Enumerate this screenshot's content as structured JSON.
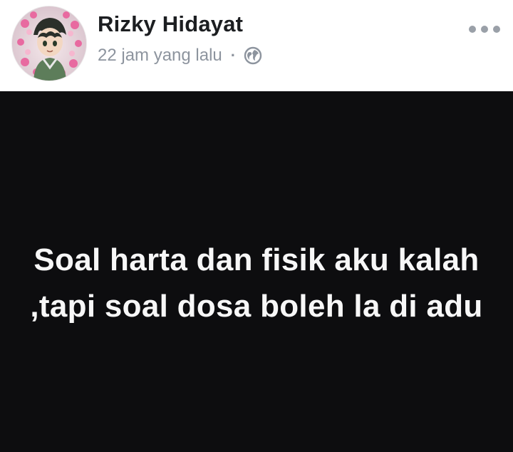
{
  "post": {
    "author": {
      "name": "Rizky Hidayat",
      "avatar": "avatar-photo"
    },
    "timestamp": "22 jam yang lalu",
    "separator": "·",
    "privacy_icon": "globe-icon",
    "more_icon": "more-options-icon",
    "content": {
      "background_color": "#0d0d0f",
      "text_color": "#f7f7f7",
      "lines": [
        "Soal harta dan fisik aku kalah",
        ",tapi soal dosa boleh la di adu"
      ]
    }
  }
}
